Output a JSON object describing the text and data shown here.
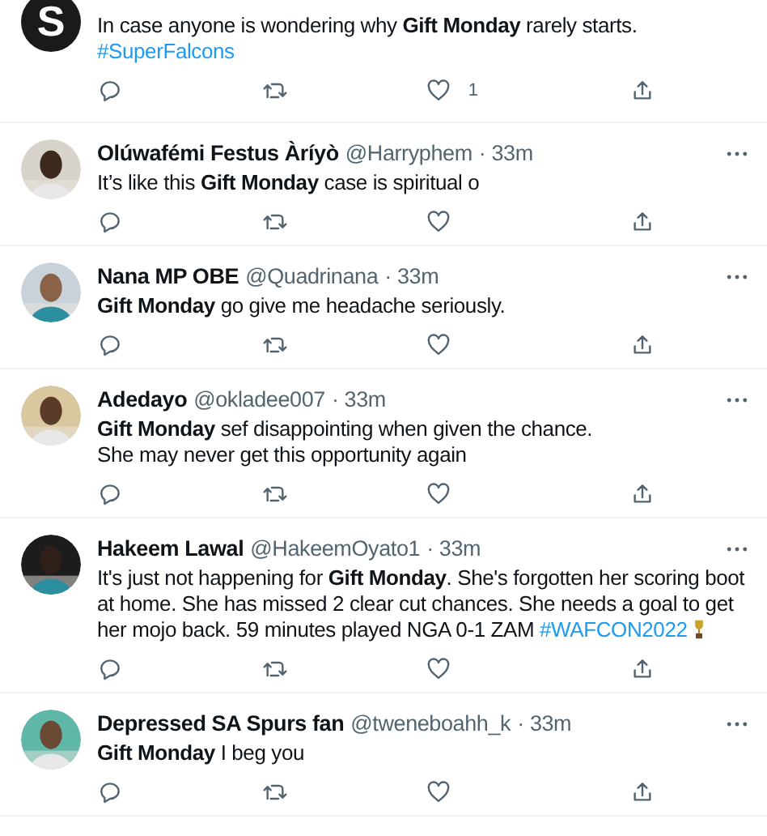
{
  "tweets": [
    {
      "avatar": {
        "kind": "letter",
        "text": "S"
      },
      "body": [
        {
          "kind": "text",
          "text": "In case anyone is wondering why **Gift Monday** rarely starts."
        },
        {
          "kind": "break"
        },
        {
          "kind": "link",
          "text": "#SuperFalcons"
        }
      ],
      "like_count": "1"
    },
    {
      "name": "Olúwafémi Festus Àríyò",
      "handle": "@Harryphem",
      "time": "· 33m",
      "body": [
        {
          "kind": "text",
          "text": "It’s like this **Gift Monday** case is spiritual o"
        }
      ]
    },
    {
      "name": "Nana MP OBE",
      "handle": "@Quadrinana",
      "time": "· 33m",
      "body": [
        {
          "kind": "text",
          "text": "**Gift Monday** go give me headache seriously."
        }
      ]
    },
    {
      "name": "Adedayo",
      "handle": "@okladee007",
      "time": "· 33m",
      "body": [
        {
          "kind": "text",
          "text": "**Gift Monday** sef disappointing when given the chance."
        },
        {
          "kind": "break"
        },
        {
          "kind": "text",
          "text": "She may never get this opportunity again"
        }
      ]
    },
    {
      "name": "Hakeem Lawal",
      "handle": "@HakeemOyato1",
      "time": "· 33m",
      "body": [
        {
          "kind": "text",
          "text": "It's just not happening for **Gift Monday**. She's forgotten her scoring boot at home.  She has missed 2 clear cut chances. She needs a goal to get her mojo back. 59 minutes played NGA 0-1 ZAM "
        },
        {
          "kind": "link",
          "text": "#WAFCON2022"
        },
        {
          "kind": "trophy"
        }
      ]
    },
    {
      "name": "Depressed SA Spurs fan",
      "handle": "@tweneboahh_k",
      "time": "· 33m",
      "body": [
        {
          "kind": "text",
          "text": "**Gift Monday** I beg you"
        }
      ]
    }
  ]
}
